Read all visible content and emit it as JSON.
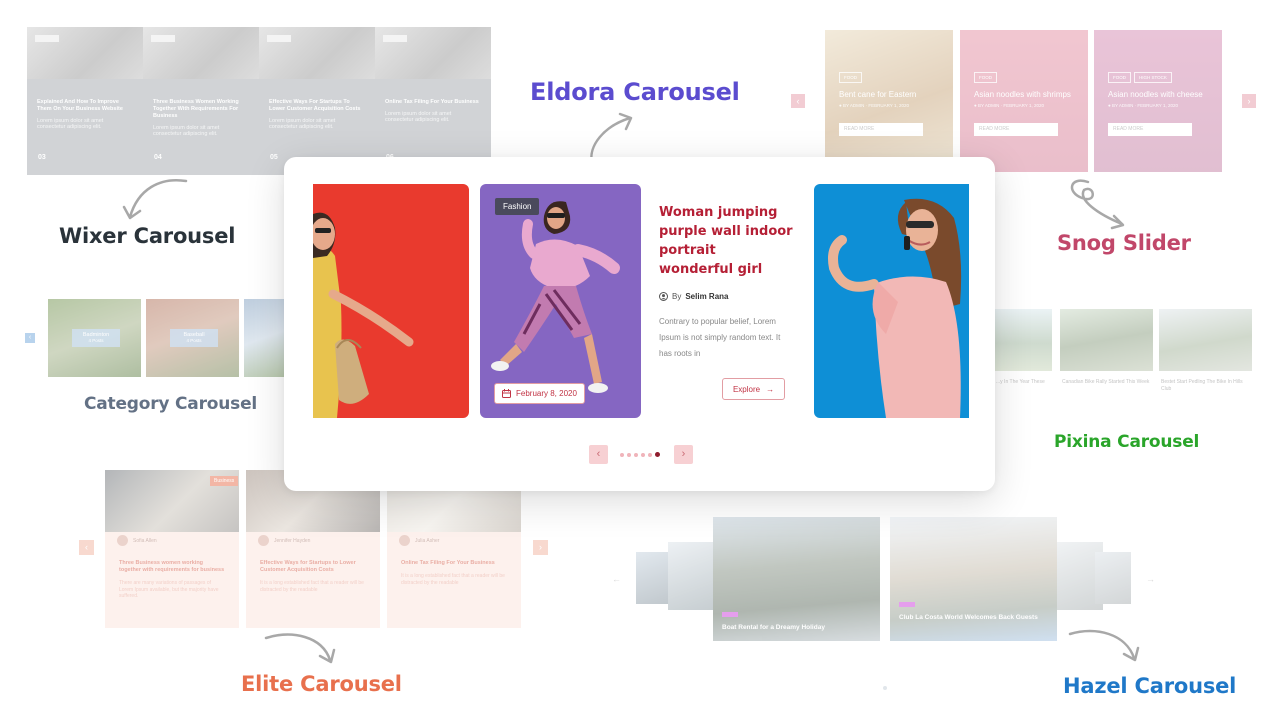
{
  "labels": {
    "eldora": {
      "text": "Eldora Carousel",
      "color": "#5b4ccf"
    },
    "wixer": {
      "text": "Wixer Carousel",
      "color": "#2a333a"
    },
    "snog": {
      "text": "Snog Slider",
      "color": "#c1476a"
    },
    "category": {
      "text": "Category Carousel",
      "color": "#637185"
    },
    "pixina": {
      "text": "Pixina Carousel",
      "color": "#2aa52a"
    },
    "elite": {
      "text": "Elite Carousel",
      "color": "#e8704d"
    },
    "hazel": {
      "text": "Hazel Carousel",
      "color": "#1f78c8"
    }
  },
  "wixer": {
    "cards": [
      {
        "title": "Explained And How To Improve Them On Your Business Website",
        "num": "03"
      },
      {
        "title": "Three Business Women Working Together With Requirements For Business",
        "num": "04"
      },
      {
        "title": "Effective Ways For Startups To Lower Customer Acquisition Costs",
        "num": "05"
      },
      {
        "title": "Online Tax Filing For Your Business",
        "num": "06"
      }
    ]
  },
  "snog": {
    "cards": [
      {
        "tags": [
          "FOOD"
        ],
        "title": "Bent cane for Eastern",
        "btn": "READ MORE"
      },
      {
        "tags": [
          "FOOD"
        ],
        "title": "Asian noodles with shrimps",
        "btn": "READ MORE"
      },
      {
        "tags": [
          "FOOD",
          "HIGH STOCK"
        ],
        "title": "Asian noodles with cheese",
        "btn": "READ MORE"
      }
    ],
    "prev": "‹",
    "next": "›"
  },
  "category": {
    "cards": [
      {
        "name": "Badminton",
        "sub": "4 Posts"
      },
      {
        "name": "Baseball",
        "sub": "4 Posts"
      },
      {
        "name": "",
        "sub": ""
      }
    ],
    "prev": "‹"
  },
  "pixina": {
    "cards": [
      {
        "text": "...y In The Year These"
      },
      {
        "text": "Canadian Bike Rally Started This Week"
      },
      {
        "text": "Bestet Start Pedling The Bike In Hills Club"
      }
    ]
  },
  "elite": {
    "cards": [
      {
        "author": "Sofia Allen",
        "title": "Three Business women working together with requirements for business",
        "text": "There are many variations of passages of Lorem Ipsum available, but the majority have suffered."
      },
      {
        "author": "Jennifer Hayden",
        "title": "Effective Ways for Startups to Lower Customer Acquisition Costs",
        "text": "It is a long established fact that a reader will be distracted by the readable"
      },
      {
        "author": "Julia Asher",
        "title": "Online Tax Filing For Your Business",
        "text": "It is a long established fact that a reader will be distracted by the readable"
      }
    ],
    "badge": "Business",
    "prev": "‹",
    "next": "›"
  },
  "hazel": {
    "cards": [
      {
        "caption": "Boat Rental for a Dreamy Holiday"
      },
      {
        "caption": "Club La Costa World Welcomes Back Guests"
      }
    ]
  },
  "eldora": {
    "tag": "Fashion",
    "date": "February 8, 2020",
    "title": "Woman jumping purple wall indoor portrait wonderful girl",
    "author_prefix": "By",
    "author": "Selim Rana",
    "excerpt": "Contrary to popular belief, Lorem Ipsum is not simply random text. It has roots in",
    "explore": "Explore",
    "prev": "‹",
    "next": "›",
    "dots": 6,
    "active_dot": 6,
    "colors": {
      "accent": "#b51f35",
      "red_bg": "#e93a2e",
      "purple_bg": "#8566c2",
      "blue_bg": "#0e8fd6"
    }
  }
}
